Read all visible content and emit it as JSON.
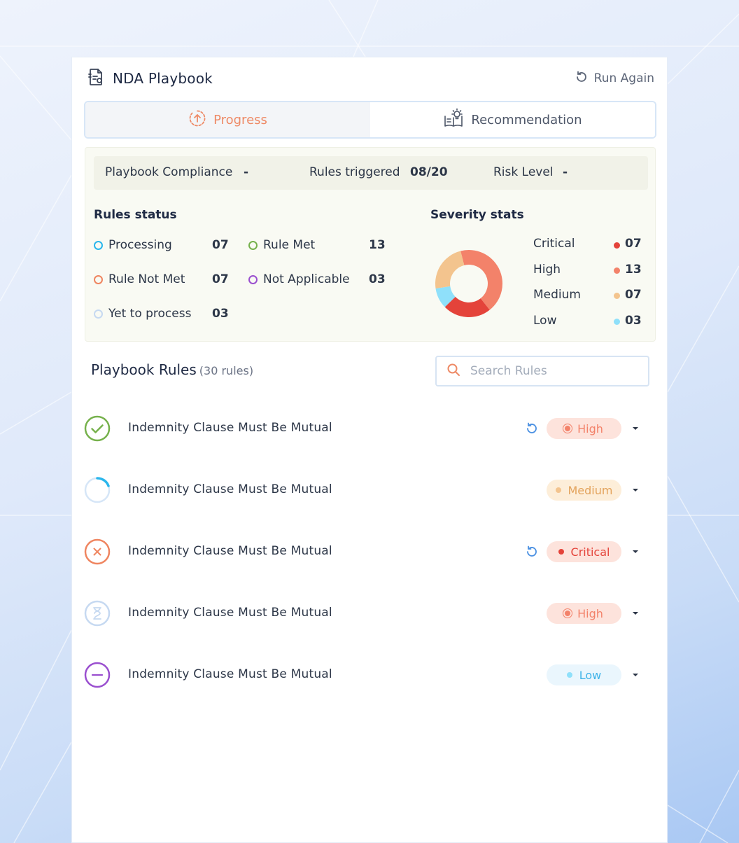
{
  "header": {
    "title": "NDA Playbook",
    "run_again": "Run Again"
  },
  "tabs": [
    {
      "label": "Progress",
      "active": true
    },
    {
      "label": "Recommendation",
      "active": false
    }
  ],
  "summary": {
    "compliance_label": "Playbook Compliance",
    "compliance_value": "-",
    "triggered_label": "Rules triggered",
    "triggered_value": "08/20",
    "risk_label": "Risk Level",
    "risk_value": "-"
  },
  "rules_status": {
    "title": "Rules status",
    "items": [
      {
        "label": "Processing",
        "count": "07",
        "color": "#2ab6ec"
      },
      {
        "label": "Rule Met",
        "count": "13",
        "color": "#76b14c"
      },
      {
        "label": "Rule Not Met",
        "count": "07",
        "color": "#ef8560"
      },
      {
        "label": "Not Applicable",
        "count": "03",
        "color": "#9a4fcf"
      },
      {
        "label": "Yet to process",
        "count": "03",
        "color": "#c6d9f1"
      }
    ]
  },
  "severity_stats": {
    "title": "Severity stats",
    "items": [
      {
        "label": "Critical",
        "count": "07",
        "color": "#e4433a"
      },
      {
        "label": "High",
        "count": "13",
        "color": "#f3826a"
      },
      {
        "label": "Medium",
        "count": "07",
        "color": "#f3c48e"
      },
      {
        "label": "Low",
        "count": "03",
        "color": "#8fe0fa"
      }
    ]
  },
  "playbook_rules": {
    "title": "Playbook Rules",
    "count": "(30 rules)",
    "search_placeholder": "Search Rules",
    "rules": [
      {
        "text": "Indemnity Clause Must Be Mutual",
        "status": "met",
        "severity": "High",
        "rerun": true
      },
      {
        "text": "Indemnity Clause Must Be Mutual",
        "status": "processing",
        "severity": "Medium",
        "rerun": false
      },
      {
        "text": "Indemnity Clause Must Be Mutual",
        "status": "not-met",
        "severity": "Critical",
        "rerun": true
      },
      {
        "text": "Indemnity Clause Must Be Mutual",
        "status": "yet-to-process",
        "severity": "High",
        "rerun": false
      },
      {
        "text": "Indemnity Clause Must Be Mutual",
        "status": "not-applicable",
        "severity": "Low",
        "rerun": false
      }
    ]
  }
}
